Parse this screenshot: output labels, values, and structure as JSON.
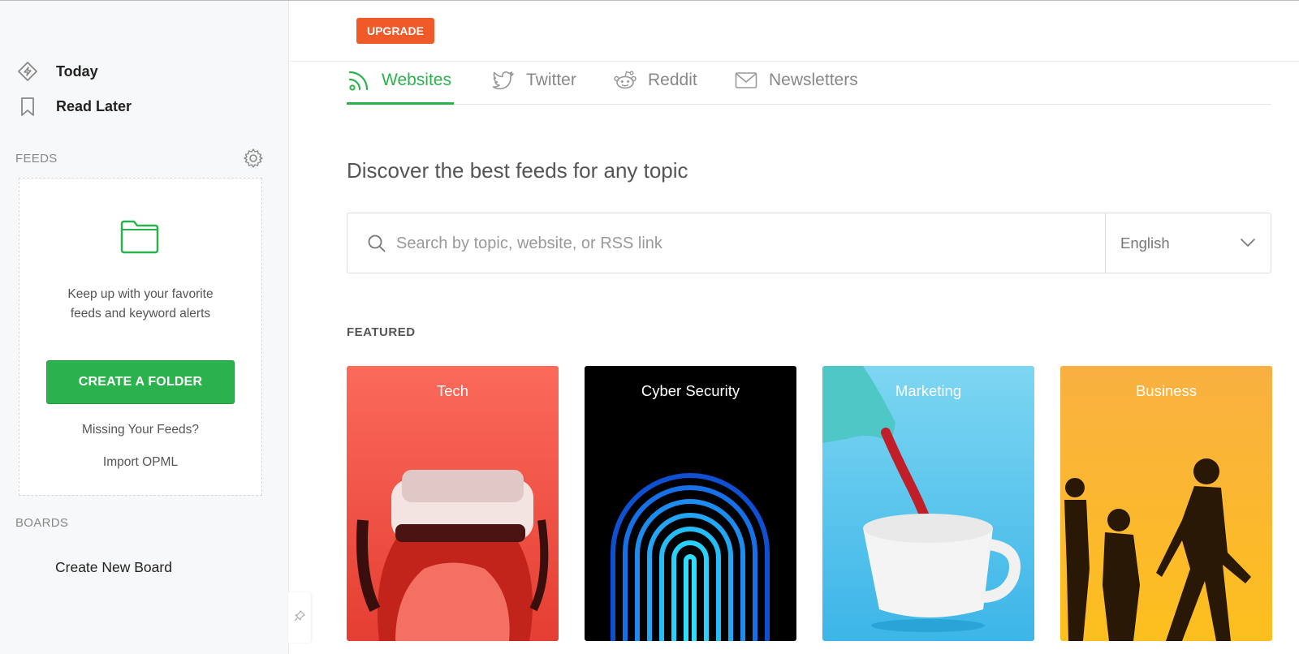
{
  "sidebar": {
    "nav": [
      {
        "label": "Today",
        "icon": "today-icon"
      },
      {
        "label": "Read Later",
        "icon": "bookmark-icon"
      }
    ],
    "feeds_title": "FEEDS",
    "feeds_box": {
      "message_line1": "Keep up with your favorite",
      "message_line2": "feeds and keyword alerts",
      "create_folder": "CREATE A FOLDER",
      "missing_feeds": "Missing Your Feeds?",
      "import_opml": "Import OPML"
    },
    "boards_title": "BOARDS",
    "create_board": "Create New Board"
  },
  "header": {
    "upgrade": "UPGRADE"
  },
  "tabs": [
    {
      "label": "Websites",
      "icon": "rss-icon",
      "active": true
    },
    {
      "label": "Twitter",
      "icon": "twitter-icon",
      "active": false
    },
    {
      "label": "Reddit",
      "icon": "reddit-icon",
      "active": false
    },
    {
      "label": "Newsletters",
      "icon": "envelope-icon",
      "active": false
    }
  ],
  "main": {
    "heading": "Discover the best feeds for any topic",
    "search": {
      "placeholder": "Search by topic, website, or RSS link",
      "value": ""
    },
    "language": "English",
    "featured_title": "FEATURED",
    "cards": [
      {
        "title": "Tech",
        "color": "#f7584a"
      },
      {
        "title": "Cyber Security",
        "color": "#000000"
      },
      {
        "title": "Marketing",
        "color": "#5ecdf0"
      },
      {
        "title": "Business",
        "color": "#fbb12c"
      }
    ]
  },
  "colors": {
    "accent": "#2bb24c",
    "upgrade": "#f05a28"
  }
}
